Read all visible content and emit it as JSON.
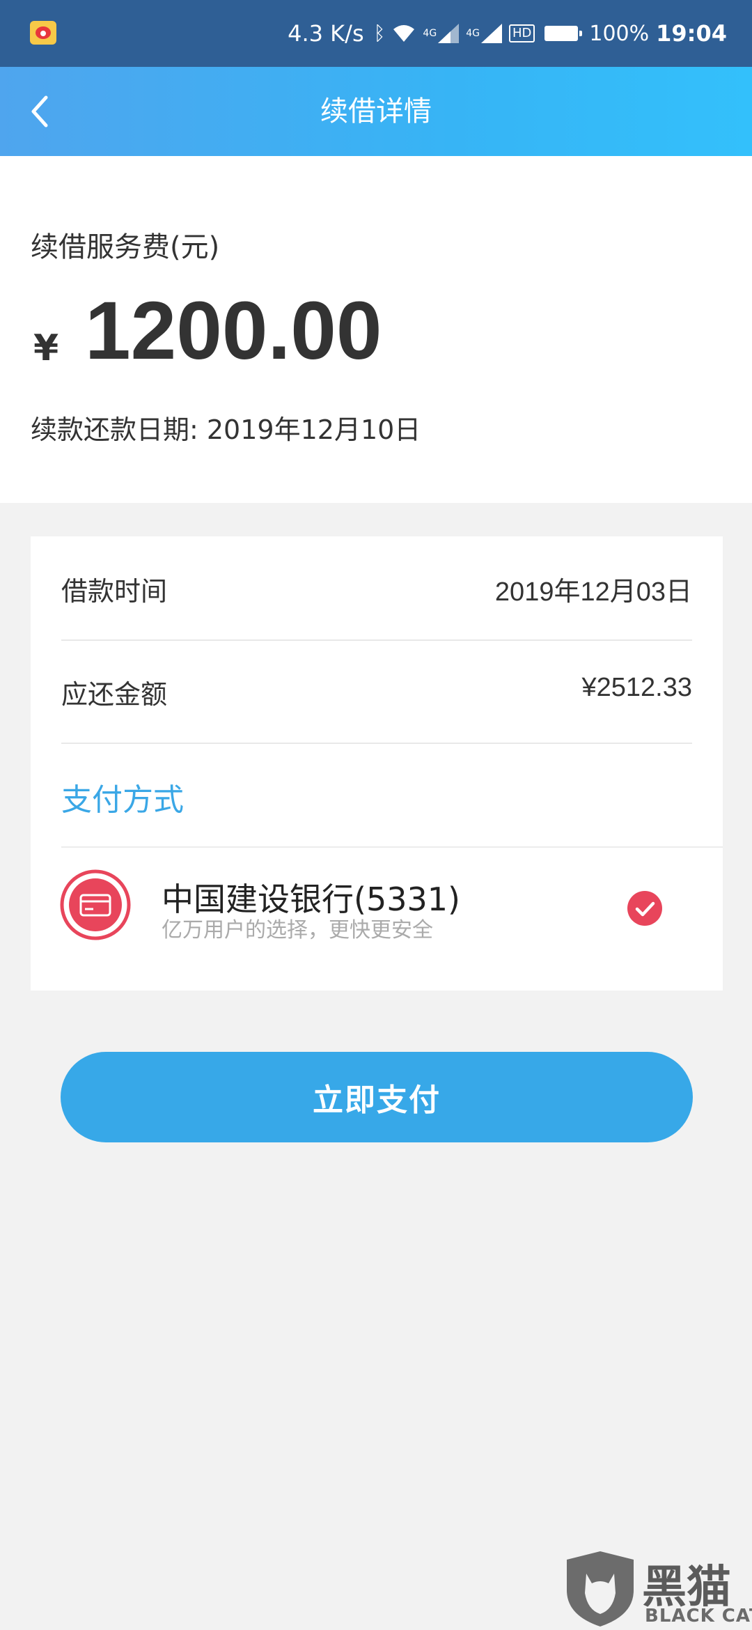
{
  "status_bar": {
    "speed": "4.3 K/s",
    "network_left": "4G",
    "network_right": "4G",
    "hd": "HD",
    "battery_percent": "100%",
    "time": "19:04"
  },
  "header": {
    "title": "续借详情"
  },
  "summary": {
    "fee_label": "续借服务费(元)",
    "currency_symbol": "¥",
    "amount": "1200.00",
    "due_label": "续款还款日期: 2019年12月10日"
  },
  "details": {
    "rows": [
      {
        "label": "借款时间",
        "value": "2019年12月03日"
      },
      {
        "label": "应还金额",
        "value": "¥2512.33"
      }
    ]
  },
  "payment": {
    "title": "支付方式",
    "bank_name": "中国建设银行(5331)",
    "bank_subtitle": "亿万用户的选择，更快更安全",
    "selected": true
  },
  "action": {
    "pay_label": "立即支付"
  },
  "watermark": {
    "cn": "黑猫",
    "en": "BLACK CAT"
  },
  "colors": {
    "accent": "#37a8e8",
    "bank_red": "#e8455b",
    "header_start": "#4fa5ee",
    "header_end": "#33c0fb"
  }
}
